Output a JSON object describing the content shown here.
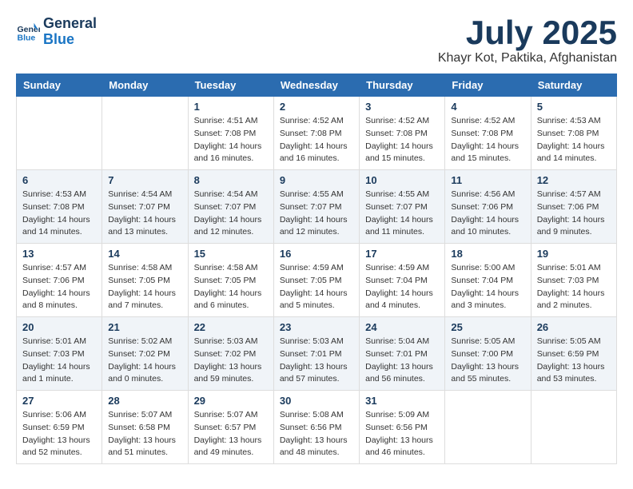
{
  "header": {
    "logo_line1": "General",
    "logo_line2": "Blue",
    "month_year": "July 2025",
    "location": "Khayr Kot, Paktika, Afghanistan"
  },
  "days_of_week": [
    "Sunday",
    "Monday",
    "Tuesday",
    "Wednesday",
    "Thursday",
    "Friday",
    "Saturday"
  ],
  "weeks": [
    [
      {
        "day": "",
        "info": ""
      },
      {
        "day": "",
        "info": ""
      },
      {
        "day": "1",
        "info": "Sunrise: 4:51 AM\nSunset: 7:08 PM\nDaylight: 14 hours\nand 16 minutes."
      },
      {
        "day": "2",
        "info": "Sunrise: 4:52 AM\nSunset: 7:08 PM\nDaylight: 14 hours\nand 16 minutes."
      },
      {
        "day": "3",
        "info": "Sunrise: 4:52 AM\nSunset: 7:08 PM\nDaylight: 14 hours\nand 15 minutes."
      },
      {
        "day": "4",
        "info": "Sunrise: 4:52 AM\nSunset: 7:08 PM\nDaylight: 14 hours\nand 15 minutes."
      },
      {
        "day": "5",
        "info": "Sunrise: 4:53 AM\nSunset: 7:08 PM\nDaylight: 14 hours\nand 14 minutes."
      }
    ],
    [
      {
        "day": "6",
        "info": "Sunrise: 4:53 AM\nSunset: 7:08 PM\nDaylight: 14 hours\nand 14 minutes."
      },
      {
        "day": "7",
        "info": "Sunrise: 4:54 AM\nSunset: 7:07 PM\nDaylight: 14 hours\nand 13 minutes."
      },
      {
        "day": "8",
        "info": "Sunrise: 4:54 AM\nSunset: 7:07 PM\nDaylight: 14 hours\nand 12 minutes."
      },
      {
        "day": "9",
        "info": "Sunrise: 4:55 AM\nSunset: 7:07 PM\nDaylight: 14 hours\nand 12 minutes."
      },
      {
        "day": "10",
        "info": "Sunrise: 4:55 AM\nSunset: 7:07 PM\nDaylight: 14 hours\nand 11 minutes."
      },
      {
        "day": "11",
        "info": "Sunrise: 4:56 AM\nSunset: 7:06 PM\nDaylight: 14 hours\nand 10 minutes."
      },
      {
        "day": "12",
        "info": "Sunrise: 4:57 AM\nSunset: 7:06 PM\nDaylight: 14 hours\nand 9 minutes."
      }
    ],
    [
      {
        "day": "13",
        "info": "Sunrise: 4:57 AM\nSunset: 7:06 PM\nDaylight: 14 hours\nand 8 minutes."
      },
      {
        "day": "14",
        "info": "Sunrise: 4:58 AM\nSunset: 7:05 PM\nDaylight: 14 hours\nand 7 minutes."
      },
      {
        "day": "15",
        "info": "Sunrise: 4:58 AM\nSunset: 7:05 PM\nDaylight: 14 hours\nand 6 minutes."
      },
      {
        "day": "16",
        "info": "Sunrise: 4:59 AM\nSunset: 7:05 PM\nDaylight: 14 hours\nand 5 minutes."
      },
      {
        "day": "17",
        "info": "Sunrise: 4:59 AM\nSunset: 7:04 PM\nDaylight: 14 hours\nand 4 minutes."
      },
      {
        "day": "18",
        "info": "Sunrise: 5:00 AM\nSunset: 7:04 PM\nDaylight: 14 hours\nand 3 minutes."
      },
      {
        "day": "19",
        "info": "Sunrise: 5:01 AM\nSunset: 7:03 PM\nDaylight: 14 hours\nand 2 minutes."
      }
    ],
    [
      {
        "day": "20",
        "info": "Sunrise: 5:01 AM\nSunset: 7:03 PM\nDaylight: 14 hours\nand 1 minute."
      },
      {
        "day": "21",
        "info": "Sunrise: 5:02 AM\nSunset: 7:02 PM\nDaylight: 14 hours\nand 0 minutes."
      },
      {
        "day": "22",
        "info": "Sunrise: 5:03 AM\nSunset: 7:02 PM\nDaylight: 13 hours\nand 59 minutes."
      },
      {
        "day": "23",
        "info": "Sunrise: 5:03 AM\nSunset: 7:01 PM\nDaylight: 13 hours\nand 57 minutes."
      },
      {
        "day": "24",
        "info": "Sunrise: 5:04 AM\nSunset: 7:01 PM\nDaylight: 13 hours\nand 56 minutes."
      },
      {
        "day": "25",
        "info": "Sunrise: 5:05 AM\nSunset: 7:00 PM\nDaylight: 13 hours\nand 55 minutes."
      },
      {
        "day": "26",
        "info": "Sunrise: 5:05 AM\nSunset: 6:59 PM\nDaylight: 13 hours\nand 53 minutes."
      }
    ],
    [
      {
        "day": "27",
        "info": "Sunrise: 5:06 AM\nSunset: 6:59 PM\nDaylight: 13 hours\nand 52 minutes."
      },
      {
        "day": "28",
        "info": "Sunrise: 5:07 AM\nSunset: 6:58 PM\nDaylight: 13 hours\nand 51 minutes."
      },
      {
        "day": "29",
        "info": "Sunrise: 5:07 AM\nSunset: 6:57 PM\nDaylight: 13 hours\nand 49 minutes."
      },
      {
        "day": "30",
        "info": "Sunrise: 5:08 AM\nSunset: 6:56 PM\nDaylight: 13 hours\nand 48 minutes."
      },
      {
        "day": "31",
        "info": "Sunrise: 5:09 AM\nSunset: 6:56 PM\nDaylight: 13 hours\nand 46 minutes."
      },
      {
        "day": "",
        "info": ""
      },
      {
        "day": "",
        "info": ""
      }
    ]
  ]
}
